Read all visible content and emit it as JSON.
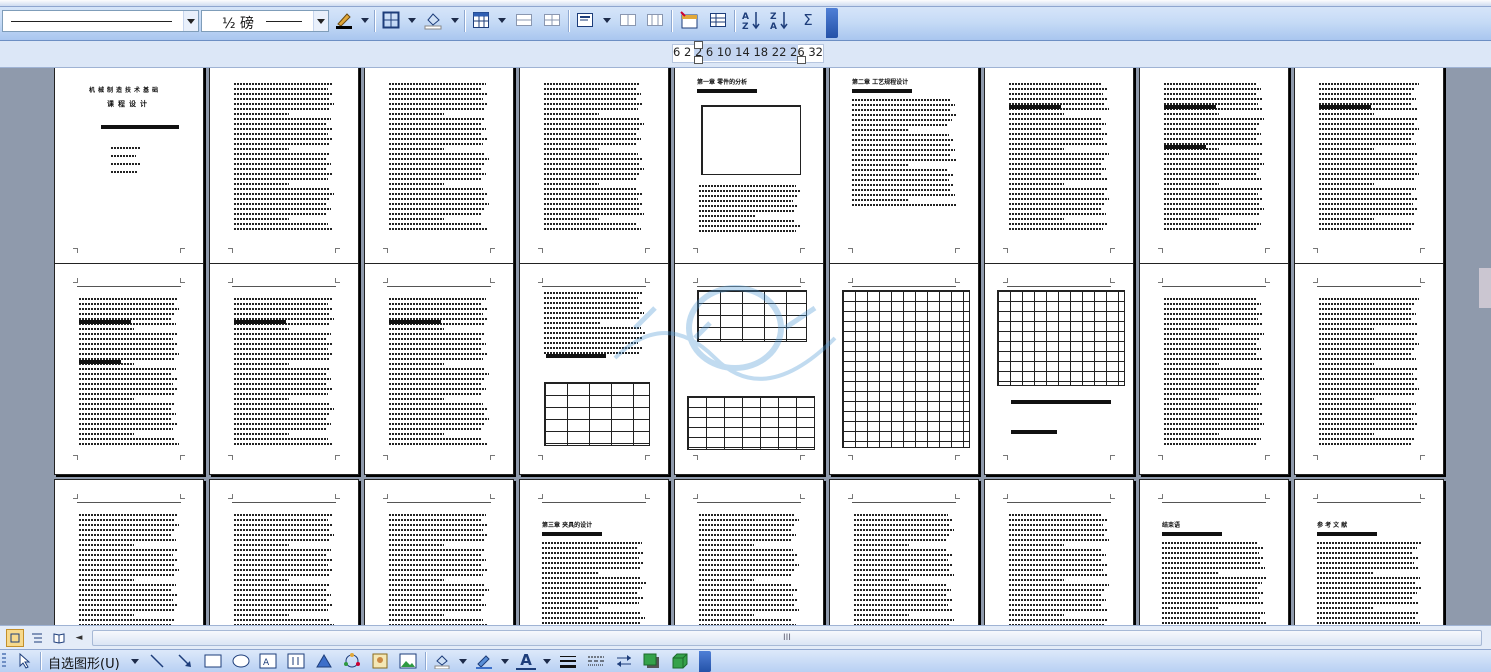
{
  "toolbar": {
    "line_weight_label": "½ 磅",
    "buttons": [
      "font-color",
      "border",
      "fill-color",
      "insert-table",
      "merge-cells",
      "split-cells",
      "align",
      "distribute-rows",
      "distribute-columns",
      "autoformat",
      "table-properties",
      "sort-ascending",
      "sort-descending",
      "autosum"
    ],
    "autosum_symbol": "Σ",
    "sort_asc_label": "A↓Z",
    "sort_desc_label": "Z↓A"
  },
  "ruler": {
    "numbers": "6  2  2  6 10 14 18 22 26  32"
  },
  "pages": {
    "p1": {
      "lines": [
        "机械制造技术基础",
        "课程设计"
      ]
    },
    "p5": {
      "heading": "第一章  零件的分析"
    },
    "p6": {
      "heading": "第二章  工艺规程设计"
    },
    "p22": {
      "heading": "第三章  夹具的设计"
    },
    "p26": {
      "heading": "结束语"
    },
    "p27": {
      "heading": "参 考 文 献"
    }
  },
  "statusbar": {
    "scroll_grip": "III",
    "scroll_left_icon": "◄"
  },
  "drawbar": {
    "autoshapes_label": "自选图形(U)",
    "text_color_label": "A"
  },
  "colors": {
    "toolbar_bg": "#c6dbf6",
    "doc_bg": "#8f9aac",
    "page": "#ffffff",
    "accent": "#2452a8"
  }
}
